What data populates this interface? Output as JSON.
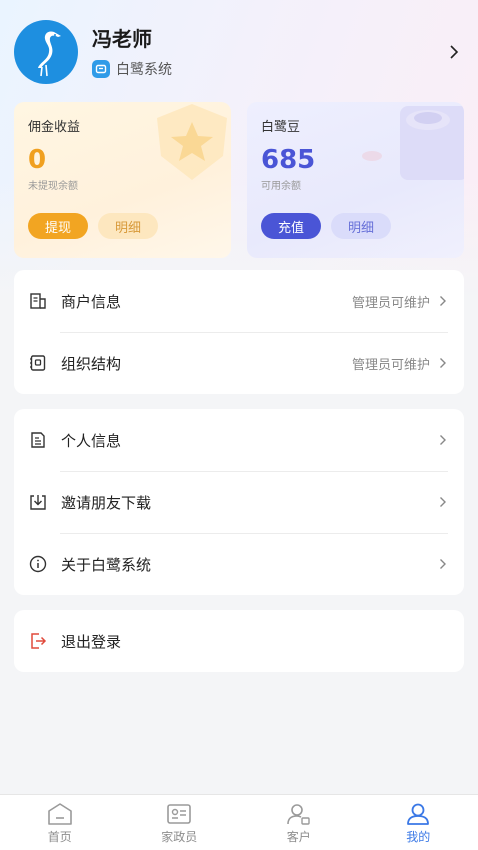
{
  "profile": {
    "name": "冯老师",
    "system": "白鹭系统",
    "avatar_icon": "egret-logo-icon"
  },
  "commission": {
    "title": "佣金收益",
    "value": "0",
    "sub": "未提现余额",
    "action_primary": "提现",
    "action_secondary": "明细",
    "accent": "#f2a522"
  },
  "beans": {
    "title": "白鹭豆",
    "value": "685",
    "sub": "可用余额",
    "action_primary": "充值",
    "action_secondary": "明细",
    "accent": "#4a55d6"
  },
  "admin_group": [
    {
      "label": "商户信息",
      "note": "管理员可维护",
      "icon": "merchant-icon"
    },
    {
      "label": "组织结构",
      "note": "管理员可维护",
      "icon": "org-structure-icon"
    }
  ],
  "personal_group": [
    {
      "label": "个人信息",
      "icon": "personal-info-icon"
    },
    {
      "label": "邀请朋友下载",
      "icon": "download-invite-icon"
    },
    {
      "label": "关于白鹭系统",
      "icon": "info-icon"
    }
  ],
  "logout": {
    "label": "退出登录",
    "icon": "logout-icon",
    "color": "#e04a3c"
  },
  "tabbar": {
    "tabs": [
      {
        "label": "首页",
        "icon": "home-icon"
      },
      {
        "label": "家政员",
        "icon": "id-card-icon"
      },
      {
        "label": "客户",
        "icon": "customer-icon"
      },
      {
        "label": "我的",
        "icon": "me-icon"
      }
    ],
    "active_index": 3,
    "active_color": "#3a78e6"
  }
}
